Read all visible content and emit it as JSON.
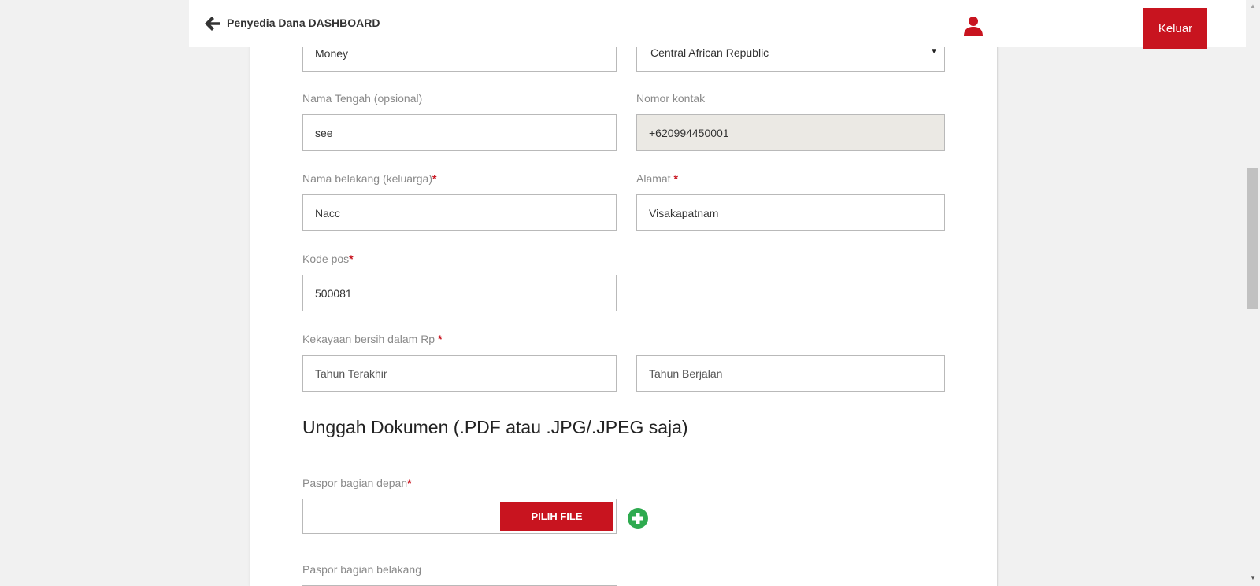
{
  "header": {
    "title": "Penyedia Dana DASHBOARD",
    "logout_label": "Keluar"
  },
  "form": {
    "first_name_value": "Money",
    "country_value": "Central African Republic",
    "middle_name_label": "Nama Tengah (opsional)",
    "middle_name_value": "see",
    "contact_label": "Nomor kontak",
    "contact_value": "+620994450001",
    "last_name_label": "Nama belakang (keluarga)",
    "last_name_value": "Nacc",
    "address_label": "Alamat ",
    "address_value": "Visakapatnam",
    "postal_label": "Kode pos",
    "postal_value": "500081",
    "net_worth_label": "Kekayaan bersih dalam Rp ",
    "last_year_placeholder": "Tahun Terakhir",
    "current_year_placeholder": "Tahun Berjalan",
    "required_mark": "*"
  },
  "upload": {
    "title": "Unggah Dokumen  (.PDF atau .JPG/.JPEG saja)",
    "passport_front_label": "Paspor bagian depan",
    "choose_file_label": "PILIH FILE",
    "passport_back_label": "Paspor bagian belakang"
  },
  "colors": {
    "accent": "#c8141f",
    "add": "#2eaa4f"
  },
  "icons": {
    "back": "arrow-left-icon",
    "user": "user-icon",
    "add": "plus-circle-icon",
    "dropdown": "caret-down-icon"
  }
}
